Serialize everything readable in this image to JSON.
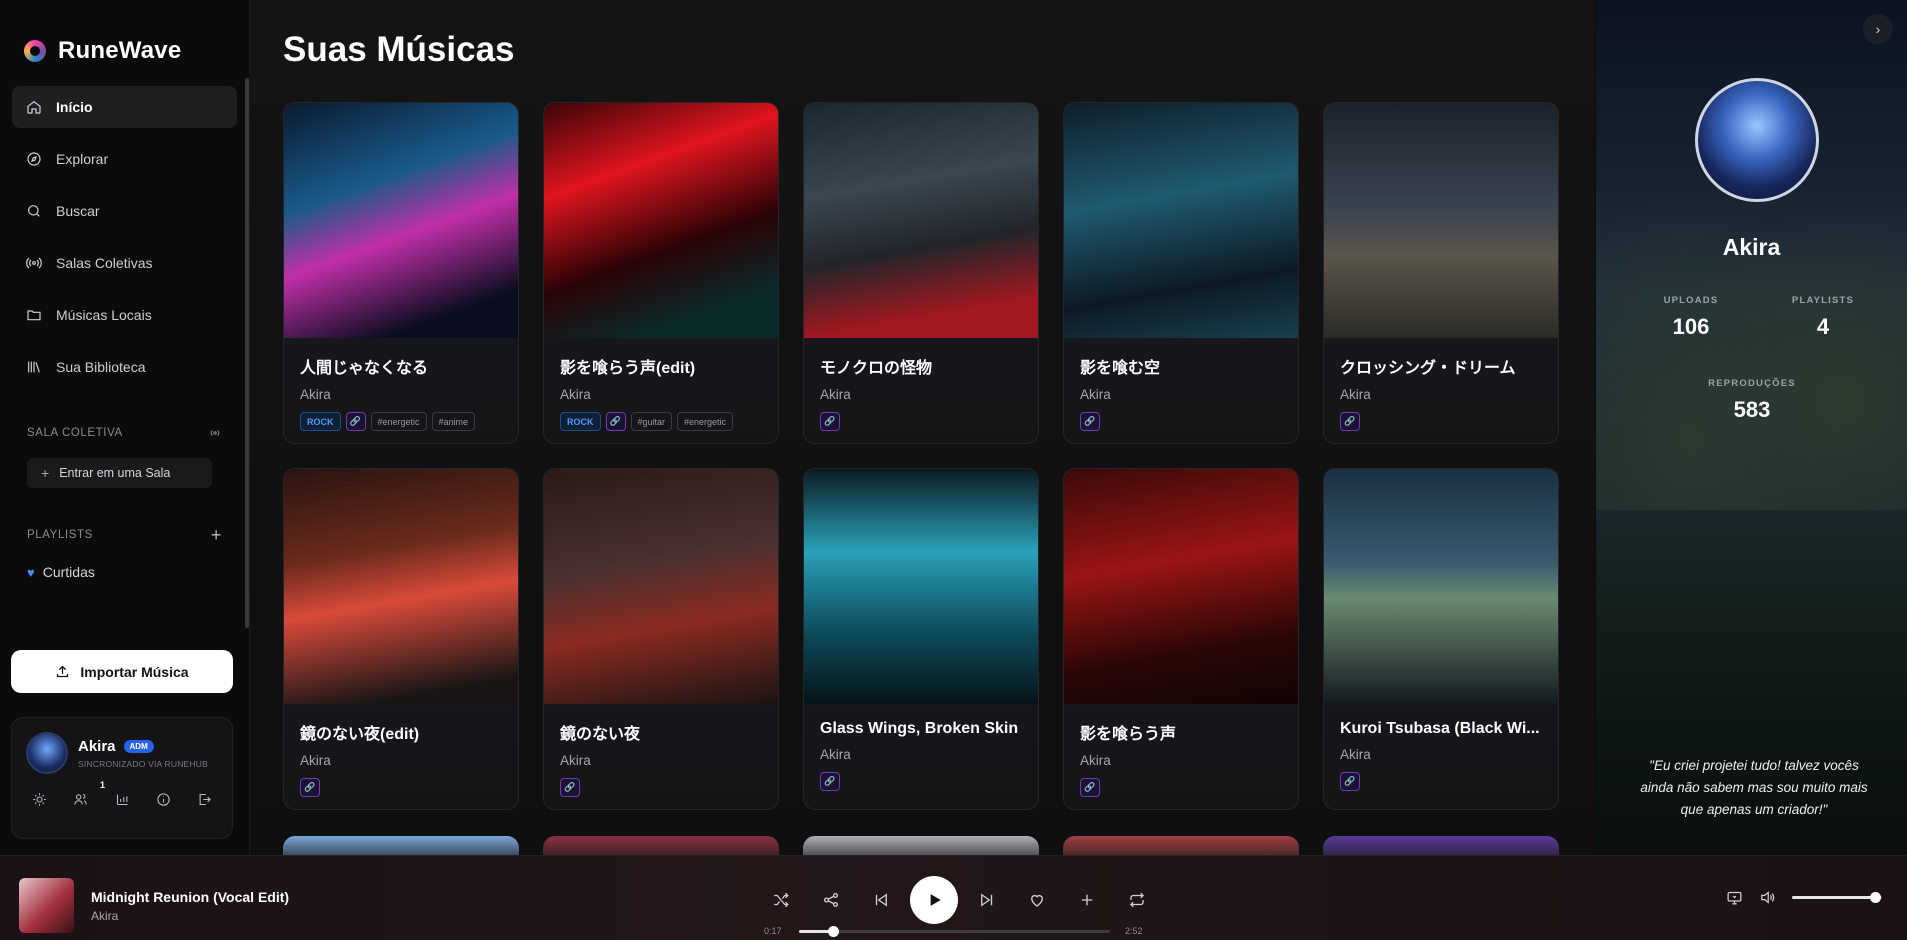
{
  "brand": {
    "name": "RuneWave"
  },
  "nav": [
    {
      "label": "Início",
      "icon": "home-icon",
      "active": true
    },
    {
      "label": "Explorar",
      "icon": "compass-icon"
    },
    {
      "label": "Buscar",
      "icon": "search-icon"
    },
    {
      "label": "Salas Coletivas",
      "icon": "broadcast-icon"
    },
    {
      "label": "Músicas Locais",
      "icon": "folder-icon"
    },
    {
      "label": "Sua Biblioteca",
      "icon": "library-icon"
    }
  ],
  "sala": {
    "heading": "SALA COLETIVA",
    "enter_label": "Entrar em uma Sala"
  },
  "playlists": {
    "heading": "PLAYLISTS",
    "items": [
      {
        "label": "Curtidas"
      }
    ]
  },
  "import_label": "Importar Música",
  "user": {
    "name": "Akira",
    "badge": "ADM",
    "sub": "SINCRONIZADO VIA RUNEHUB",
    "friends_count": "1"
  },
  "main": {
    "title": "Suas Músicas",
    "tracks": [
      {
        "title": "人間じゃなくなる",
        "artist": "Akira",
        "tags": [
          "ROCK",
          "link",
          "#energetic",
          "#anime"
        ],
        "cover": "linear-gradient(160deg,#0a1a30 0%,#1a5a8a 35%,#c02fa8 55%,#0a0d20 85%)"
      },
      {
        "title": "影を喰らう声(edit)",
        "artist": "Akira",
        "tags": [
          "ROCK",
          "link",
          "#guitar",
          "#energetic"
        ],
        "cover": "linear-gradient(160deg,#3a0508 0%,#e0141e 30%,#2a0306 60%,#0a2a2a 85%)"
      },
      {
        "title": "モノクロの怪物",
        "artist": "Akira",
        "tags": [
          "link"
        ],
        "cover": "linear-gradient(170deg,#1a2630 0%,#3a4650 35%,#22252a 60%,#a01820 85%)"
      },
      {
        "title": "影を喰む空",
        "artist": "Akira",
        "tags": [
          "link"
        ],
        "cover": "linear-gradient(170deg,#0f1e2a 0%,#1f5a70 40%,#0d1a24 75%,#184050 100%)"
      },
      {
        "title": "クロッシング・ドリーム",
        "artist": "Akira",
        "tags": [
          "link"
        ],
        "cover": "linear-gradient(180deg,#1b222c 0%,#3a4350 45%,#5a554a 65%,#2c2b28 100%)"
      },
      {
        "title": "鏡のない夜(edit)",
        "artist": "Akira",
        "tags": [
          "link"
        ],
        "cover": "linear-gradient(170deg,#2a1410 0%,#6a2a1c 35%,#d84a3a 55%,#1a1616 90%)"
      },
      {
        "title": "鏡のない夜",
        "artist": "Akira",
        "tags": [
          "link"
        ],
        "cover": "linear-gradient(170deg,#2a1a18 0%,#4a3030 40%,#8a2a20 65%,#1a1414 100%)"
      },
      {
        "title": "Glass Wings, Broken Skin",
        "artist": "Akira",
        "tags": [
          "link"
        ],
        "cover": "linear-gradient(180deg,#0a1a22 0%,#2aa0b8 35%,#0d4a5a 70%,#061418 100%)"
      },
      {
        "title": "影を喰らう声",
        "artist": "Akira",
        "tags": [
          "link"
        ],
        "cover": "linear-gradient(170deg,#3a0a0a 0%,#9a1414 40%,#2a0606 75%,#120404 100%)"
      },
      {
        "title": "Kuroi Tsubasa (Black Wi...",
        "artist": "Akira",
        "tags": [
          "link"
        ],
        "cover": "linear-gradient(180deg,#1a3040 0%,#3a5a70 40%,#6a8a70 55%,#141a1e 100%)"
      }
    ],
    "row3_colors": [
      "#7aa6d8",
      "#8a3040",
      "#b0b0b8",
      "#a04040",
      "#5a3a9a"
    ]
  },
  "profile": {
    "name": "Akira",
    "stats": [
      {
        "label": "UPLOADS",
        "value": "106"
      },
      {
        "label": "PLAYLISTS",
        "value": "4"
      },
      {
        "label": "REPRODUÇÕES",
        "value": "583"
      }
    ],
    "quote": "\"Eu criei projetei tudo! talvez vocês ainda não sabem mas sou muito mais que apenas um criador!\""
  },
  "player": {
    "title": "Midnight Reunion (Vocal Edit)",
    "artist": "Akira",
    "current_time": "0:17",
    "total_time": "2:52",
    "progress": 0.11,
    "volume": 0.92
  }
}
